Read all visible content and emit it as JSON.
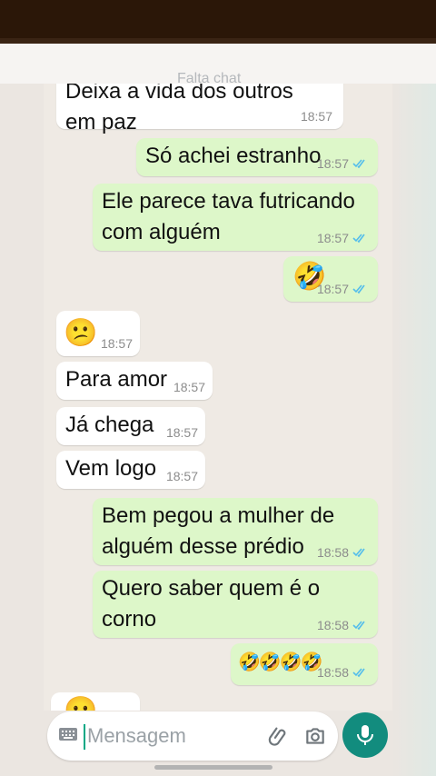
{
  "header": {
    "faded_title": "Falta chat"
  },
  "messages": [
    {
      "dir": "in",
      "text": "Deixa a vida dos outros\nem paz",
      "time": "18:57"
    },
    {
      "dir": "out",
      "text": "Só achei estranho",
      "time": "18:57",
      "read": true
    },
    {
      "dir": "out",
      "text": "Ele parece tava futricando\ncom alguém",
      "time": "18:57",
      "read": true
    },
    {
      "dir": "out",
      "text": "🤣",
      "time": "18:57",
      "read": true
    },
    {
      "dir": "in",
      "text": "😕",
      "time": "18:57"
    },
    {
      "dir": "in",
      "text": "Para amor",
      "time": "18:57"
    },
    {
      "dir": "in",
      "text": "Já chega",
      "time": "18:57"
    },
    {
      "dir": "in",
      "text": "Vem logo",
      "time": "18:57"
    },
    {
      "dir": "out",
      "text": "Bem pegou a mulher de\nalguém desse prédio",
      "time": "18:58",
      "read": true
    },
    {
      "dir": "out",
      "text": "Quero saber quem é o\ncorno",
      "time": "18:58",
      "read": true
    },
    {
      "dir": "out",
      "text": "🤣🤣🤣🤣",
      "time": "18:58",
      "read": true
    },
    {
      "dir": "in",
      "text": "😐",
      "time": ""
    }
  ],
  "composer": {
    "placeholder": "Mensagem",
    "icons": [
      "keyboard-icon",
      "paperclip-icon",
      "camera-icon"
    ],
    "mic_icon": "microphone-icon"
  },
  "colors": {
    "incoming": "#ffffff",
    "outgoing": "#ddf7c9",
    "accent": "#128c7e",
    "read_ticks": "#53bdeb",
    "chat_background": "#efeae4"
  }
}
